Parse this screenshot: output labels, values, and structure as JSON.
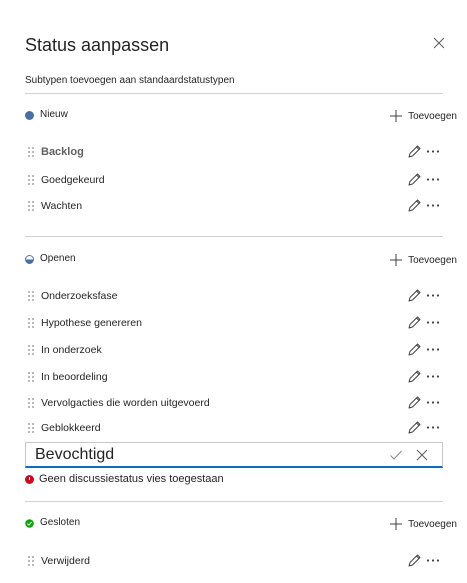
{
  "dialog": {
    "title": "Status aanpassen",
    "subtitle": "Subtypen toevoegen aan standaardstatustypen"
  },
  "sections": [
    {
      "label": "Nieuw",
      "color": "#4a6fa5",
      "add_label": "Toevoegen",
      "items": [
        "Backlog",
        "Goedgekeurd",
        "Wachten"
      ]
    },
    {
      "label": "Openen",
      "color": "#4a6fa5",
      "add_label": "Toevoegen",
      "items": [
        "Onderzoeksfase",
        "Hypothese genereren",
        "In onderzoek",
        "In beoordeling",
        "Vervolgacties die worden uitgevoerd",
        "Geblokkeerd"
      ]
    },
    {
      "label": "Gesloten",
      "color": "#13a10e",
      "add_label": "Toevoegen",
      "items": [
        "Verwijderd"
      ]
    }
  ],
  "editor": {
    "value": "Bevochtigd",
    "error": "Geen discussiestatus vies toegestaan"
  },
  "colors": {
    "accent": "#0f6cbd",
    "error": "#c50f1f"
  }
}
